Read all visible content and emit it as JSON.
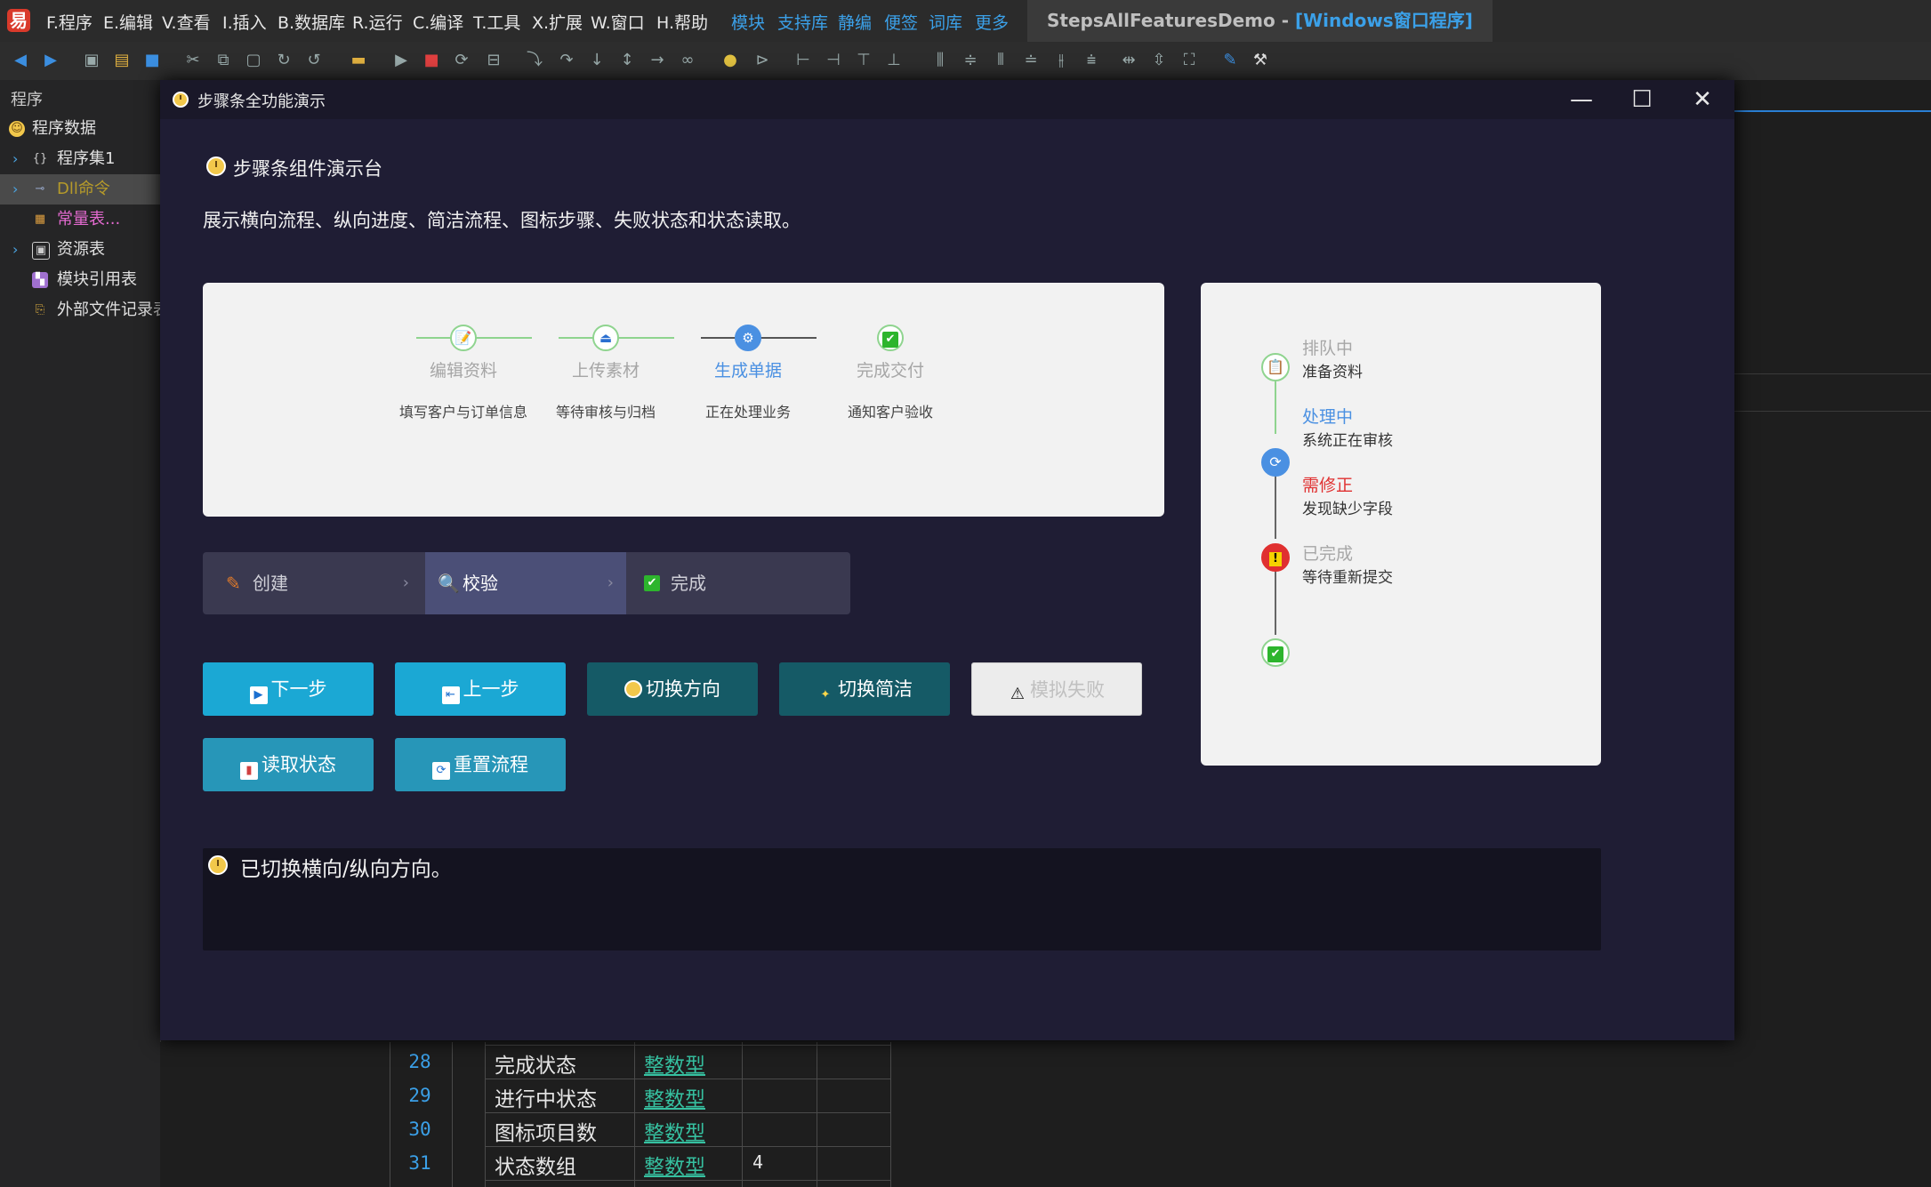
{
  "menubar": {
    "items": [
      "F.程序",
      "E.编辑",
      "V.查看",
      "I.插入",
      "B.数据库",
      "R.运行",
      "C.编译",
      "T.工具",
      "X.扩展",
      "W.窗口",
      "H.帮助"
    ],
    "links": [
      "模块",
      "支持库",
      "静编",
      "便签",
      "词库",
      "更多"
    ],
    "title_main": "StepsAllFeaturesDemo - ",
    "title_sub": "[Windows窗口程序]"
  },
  "sidebar": {
    "header": "程序",
    "items": [
      {
        "label": "程序数据"
      },
      {
        "label": "程序集1"
      },
      {
        "label": "Dll命令"
      },
      {
        "label": "常量表..."
      },
      {
        "label": "资源表"
      },
      {
        "label": "模块引用表"
      },
      {
        "label": "外部文件记录表"
      }
    ]
  },
  "editor": {
    "rows": [
      {
        "num": "28",
        "name": "完成状态",
        "type": "整数型",
        "value": ""
      },
      {
        "num": "29",
        "name": "进行中状态",
        "type": "整数型",
        "value": ""
      },
      {
        "num": "30",
        "name": "图标项目数",
        "type": "整数型",
        "value": ""
      },
      {
        "num": "31",
        "name": "状态数组",
        "type": "整数型",
        "value": "4"
      }
    ]
  },
  "dialog": {
    "title": "步骤条全功能演示",
    "heading": "步骤条组件演示台",
    "description": "展示横向流程、纵向进度、简洁流程、图标步骤、失败状态和状态读取。",
    "horizontal_steps": [
      {
        "title": "编辑资料",
        "desc": "填写客户与订单信息",
        "state": "done",
        "icon": "📝"
      },
      {
        "title": "上传素材",
        "desc": "等待审核与归档",
        "state": "done",
        "icon": "⏏"
      },
      {
        "title": "生成单据",
        "desc": "正在处理业务",
        "state": "process",
        "icon": "⚙"
      },
      {
        "title": "完成交付",
        "desc": "通知客户验收",
        "state": "wait",
        "icon": "✔"
      }
    ],
    "vertical_steps": [
      {
        "title": "排队中",
        "desc": "准备资料",
        "state": "done",
        "icon": "📋"
      },
      {
        "title": "处理中",
        "desc": "系统正在审核",
        "state": "process",
        "icon": "⟳"
      },
      {
        "title": "需修正",
        "desc": "发现缺少字段",
        "state": "error",
        "icon": "!"
      },
      {
        "title": "已完成",
        "desc": "等待重新提交",
        "state": "wait",
        "icon": "✔"
      }
    ],
    "compact_steps": [
      {
        "label": "创建",
        "state": "done"
      },
      {
        "label": "校验",
        "state": "active"
      },
      {
        "label": "完成",
        "state": "wait"
      }
    ],
    "buttons": {
      "next": "下一步",
      "prev": "上一步",
      "toggle_dir": "切换方向",
      "toggle_simple": "切换简洁",
      "simulate_fail": "模拟失败",
      "read_state": "读取状态",
      "reset": "重置流程"
    },
    "status_text": "已切换横向/纵向方向。"
  },
  "colors": {
    "done": "#8fd48f",
    "process": "#4a90e2",
    "error": "#e03030",
    "wait": "#a6a6a6",
    "btn_cyan": "#1ba8d4",
    "btn_teal": "#155a66"
  }
}
